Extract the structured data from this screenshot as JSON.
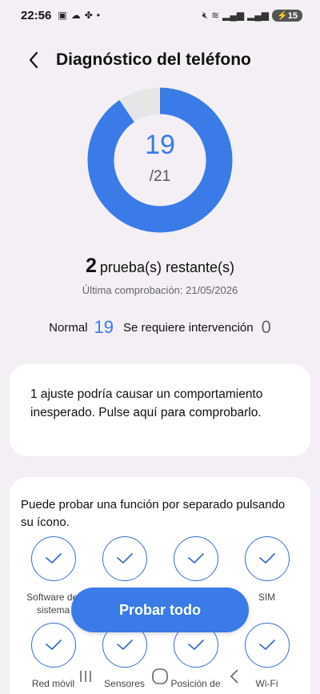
{
  "status_bar": {
    "time": "22:56",
    "battery": "15"
  },
  "header": {
    "title": "Diagnóstico del teléfono"
  },
  "progress": {
    "completed": "19",
    "total": "/21",
    "fraction_done": 0.905
  },
  "remaining": {
    "count": "2",
    "text": "prueba(s) restante(s)"
  },
  "last_check": "Última comprobación: 21/05/2026",
  "summary": {
    "normal_label": "Normal",
    "normal_value": "19",
    "intervention_label": "Se requiere intervención",
    "intervention_value": "0"
  },
  "warning_card": {
    "text": "1 ajuste podría causar un comportamiento inesperado. Pulse aquí para comprobarlo."
  },
  "tests_card": {
    "hint": "Puede probar una función por separado pulsando su ícono.",
    "items": [
      {
        "label": "Software del sistema"
      },
      {
        "label": ""
      },
      {
        "label": ""
      },
      {
        "label": "SIM"
      },
      {
        "label": "Red móvil"
      },
      {
        "label": "Sensores"
      },
      {
        "label": "Posición de"
      },
      {
        "label": "Wi-Fi"
      }
    ]
  },
  "fab": {
    "label": "Probar todo"
  },
  "colors": {
    "accent": "#3a7be8",
    "track": "#e6e6e8",
    "background": "#f3eff4"
  }
}
